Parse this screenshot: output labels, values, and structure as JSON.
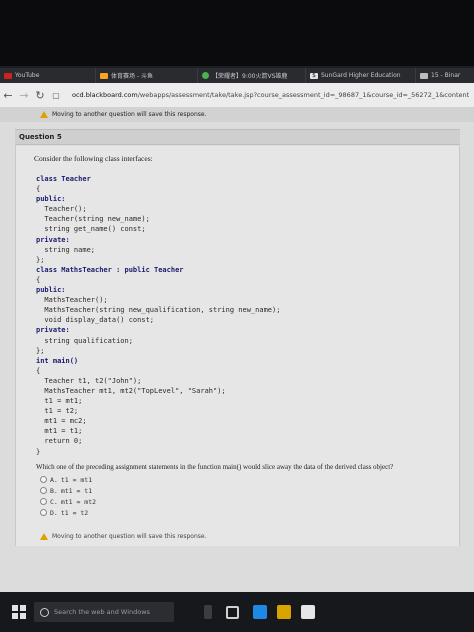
{
  "tabs": [
    {
      "label": "YouTube",
      "icon": "youtube-icon",
      "color": "#cc2222"
    },
    {
      "label": "体育赛场 - 斗鱼",
      "icon": "douyu-icon",
      "color": "#f5a623"
    },
    {
      "label": "【荣耀者】9:00火箭VS雄鹿",
      "icon": "browser-tab-icon",
      "color": "#4caf50"
    },
    {
      "label": "SunGard Higher Education",
      "icon": "dollar-icon",
      "color": "#e5e5e5"
    },
    {
      "label": "15 - Binar",
      "icon": "page-icon",
      "color": "#bbbbbb"
    }
  ],
  "address": {
    "domain": "ocd.blackboard.com",
    "path": "/webapps/assessment/take/take.jsp?course_assessment_id=_98687_1&course_id=_56272_1&content"
  },
  "warning": "Moving to another question will save this response.",
  "question": {
    "title": "Question 5",
    "prompt": "Consider the following class interfaces:",
    "code": [
      "class Teacher",
      "{",
      "public:",
      "  Teacher();",
      "  Teacher(string new_name);",
      "  string get_name() const;",
      "private:",
      "  string name;",
      "};",
      "class MathsTeacher : public Teacher",
      "{",
      "public:",
      "  MathsTeacher();",
      "  MathsTeacher(string new_qualification, string new_name);",
      "  void display_data() const;",
      "private:",
      "  string qualification;",
      "};",
      "int main()",
      "{",
      "  Teacher t1, t2(\"John\");",
      "  MathsTeacher mt1, mt2(\"TopLevel\", \"Sarah\");",
      "  t1 = mt1;",
      "  t1 = t2;",
      "  mt1 = mc2;",
      "  mt1 = t1;",
      "  return 0;",
      "}"
    ],
    "ask": "Which one of the preceding assignment statements in the function main() would slice away the data of the derived class object?",
    "options": [
      {
        "letter": "A.",
        "text": "t1 = mt1"
      },
      {
        "letter": "B.",
        "text": "mt1 = t1"
      },
      {
        "letter": "C.",
        "text": "mt1 = mt2"
      },
      {
        "letter": "D.",
        "text": "t1 = t2"
      }
    ]
  },
  "footer_warning": "Moving to another question will save this response.",
  "taskbar": {
    "search_placeholder": "Search the web and Windows"
  }
}
